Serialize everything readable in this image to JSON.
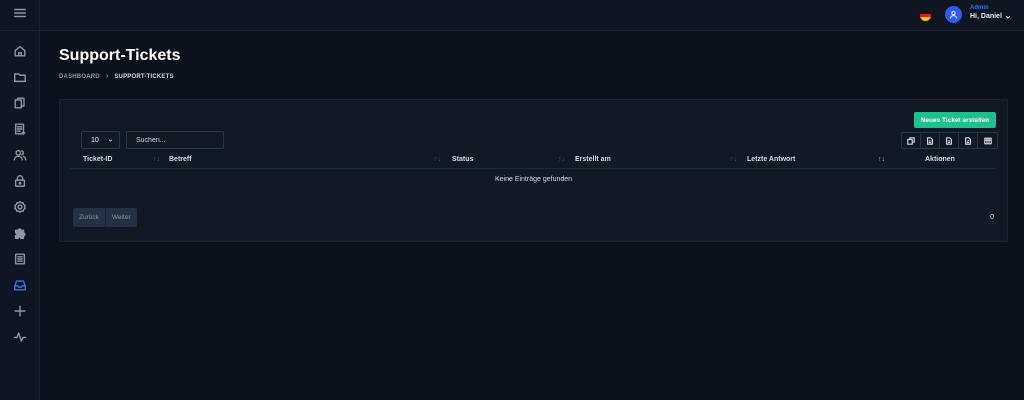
{
  "header": {
    "user_role": "Admin",
    "greeting": "Hi, Daniel",
    "language_flag": "de-flag-icon"
  },
  "sidebar": {
    "toggle": "hamburger-icon",
    "items": [
      {
        "icon": "home-icon"
      },
      {
        "icon": "folder-icon"
      },
      {
        "icon": "copy-icon"
      },
      {
        "icon": "invoice-icon"
      },
      {
        "icon": "users-icon"
      },
      {
        "icon": "lock-icon"
      },
      {
        "icon": "gear-icon"
      },
      {
        "icon": "puzzle-icon"
      },
      {
        "icon": "document-icon"
      },
      {
        "icon": "inbox-icon",
        "active": true
      },
      {
        "icon": "plus-icon"
      },
      {
        "icon": "activity-icon"
      }
    ]
  },
  "page": {
    "title": "Support-Tickets",
    "breadcrumb": [
      "DASHBOARD",
      "SUPPORT-TICKETS"
    ]
  },
  "table": {
    "new_button": "Neues Ticket erstellen",
    "page_length": "10",
    "search_placeholder": "Suchen...",
    "columns": [
      "Ticket-ID",
      "Betreff",
      "Status",
      "Erstellt am",
      "Letzte Antwort",
      "Aktionen"
    ],
    "empty_message": "Keine Einträge gefunden",
    "pagination": {
      "prev": "Zurück",
      "next": "Weiter"
    },
    "record_count": "0",
    "export_buttons": [
      "copy-icon",
      "csv-icon",
      "excel-icon",
      "pdf-icon",
      "columns-icon"
    ]
  },
  "colors": {
    "background": "#0b111b",
    "card": "#111925",
    "accent": "#1fbf8f",
    "primary": "#3b6cf5"
  }
}
